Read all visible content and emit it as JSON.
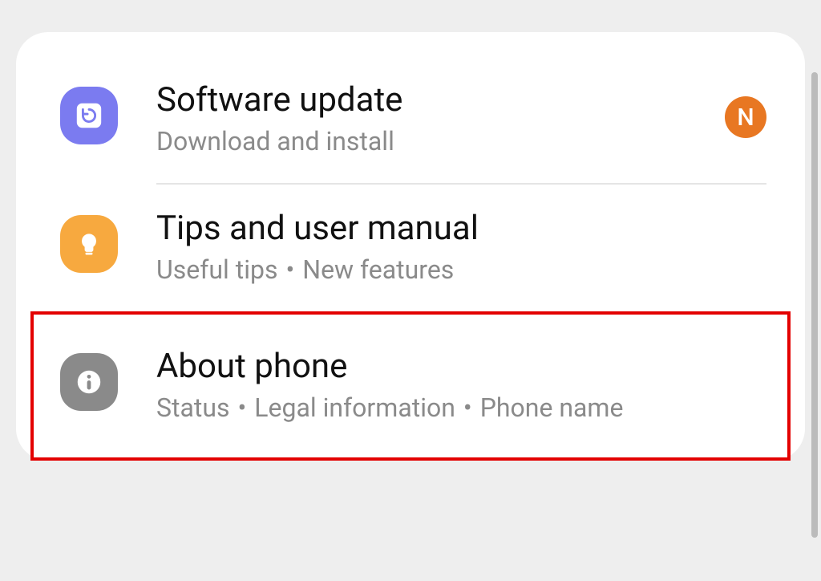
{
  "items": [
    {
      "title": "Software update",
      "subtitle": "Download and install",
      "badge": "N"
    },
    {
      "title": "Tips and user manual",
      "sub_parts": [
        "Useful tips",
        "New features"
      ]
    },
    {
      "title": "About phone",
      "sub_parts": [
        "Status",
        "Legal information",
        "Phone name"
      ]
    }
  ]
}
